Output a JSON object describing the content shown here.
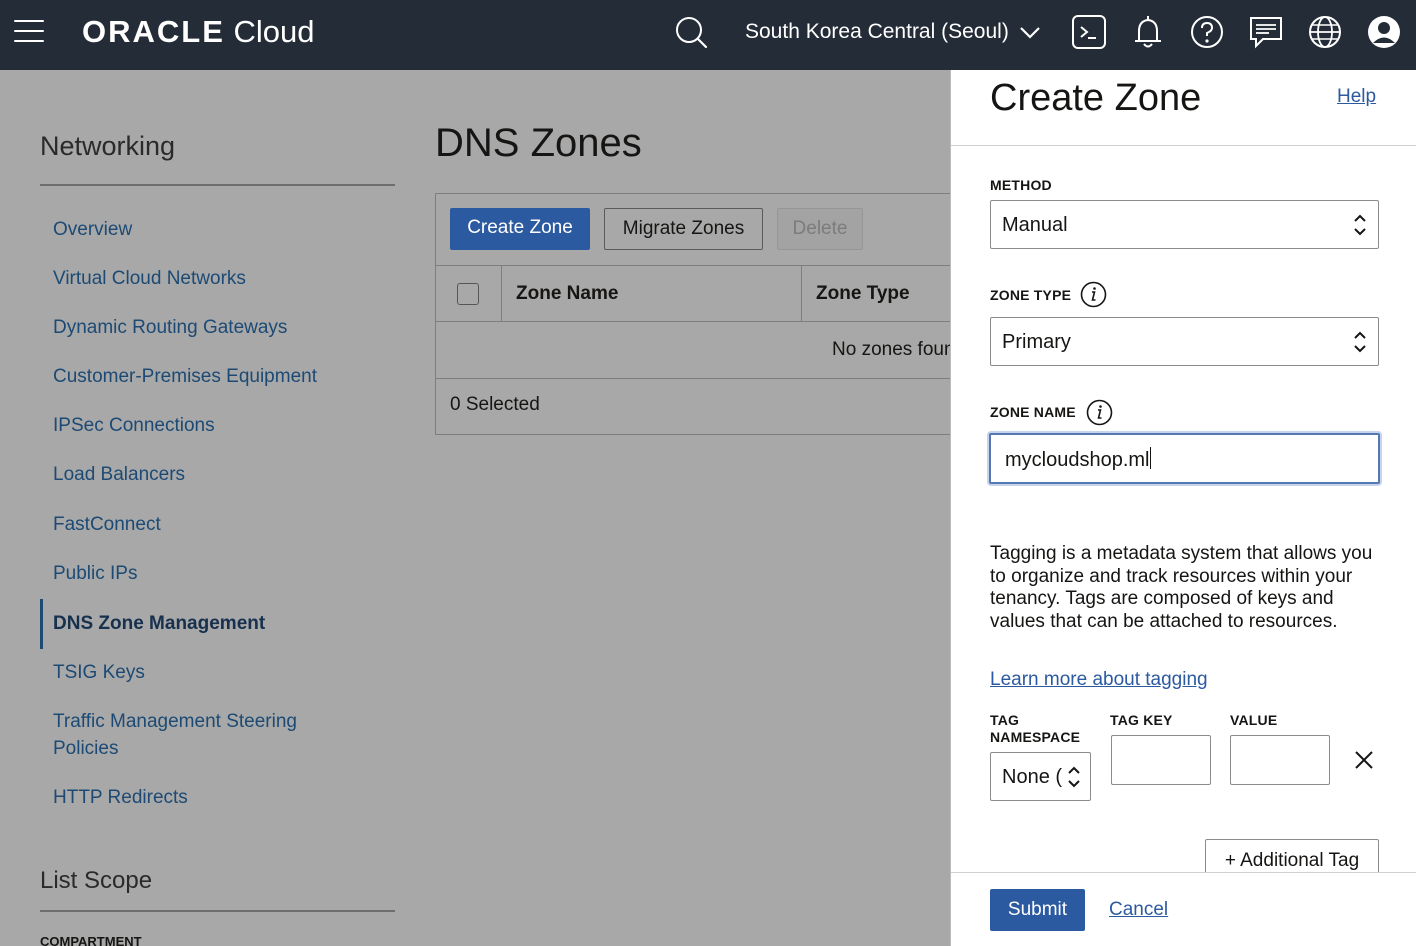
{
  "header": {
    "brand_bold": "ORACLE",
    "brand_light": "Cloud",
    "region": "South Korea Central (Seoul)"
  },
  "nav": {
    "title": "Networking",
    "items": [
      {
        "label": "Overview"
      },
      {
        "label": "Virtual Cloud Networks"
      },
      {
        "label": "Dynamic Routing Gateways"
      },
      {
        "label": "Customer-Premises Equipment"
      },
      {
        "label": "IPSec Connections"
      },
      {
        "label": "Load Balancers"
      },
      {
        "label": "FastConnect"
      },
      {
        "label": "Public IPs"
      },
      {
        "label": "DNS Zone Management"
      },
      {
        "label": "TSIG Keys"
      },
      {
        "label": "Traffic Management Steering Policies"
      },
      {
        "label": "HTTP Redirects"
      }
    ],
    "active_item": "DNS Zone Management",
    "scope_title": "List Scope",
    "compartment_label": "COMPARTMENT"
  },
  "main": {
    "title": "DNS Zones",
    "buttons": {
      "create": "Create Zone",
      "migrate": "Migrate Zones",
      "delete": "Delete"
    },
    "table": {
      "columns": [
        "Zone Name",
        "Zone Type"
      ],
      "empty_text": "No zones found.",
      "selected_text": "0 Selected"
    }
  },
  "drawer": {
    "title": "Create Zone",
    "help_link": "Help",
    "method_label": "METHOD",
    "method_value": "Manual",
    "zone_type_label": "ZONE TYPE",
    "zone_type_value": "Primary",
    "zone_name_label": "ZONE NAME",
    "zone_name_value": "mycloudshop.ml",
    "tagging_text": "Tagging is a metadata system that allows you to organize and track resources within your tenancy. Tags are composed of keys and values that can be attached to resources.",
    "tagging_link": "Learn more about tagging",
    "tag_namespace_label": "TAG NAMESPACE",
    "tag_namespace_value": "None (",
    "tag_key_label": "TAG KEY",
    "tag_value_label": "VALUE",
    "additional_tag": "+ Additional Tag",
    "submit": "Submit",
    "cancel": "Cancel"
  },
  "colors": {
    "header_bg": "#242d37",
    "accent": "#2c5aa0",
    "nav_link": "#1c4a74"
  }
}
